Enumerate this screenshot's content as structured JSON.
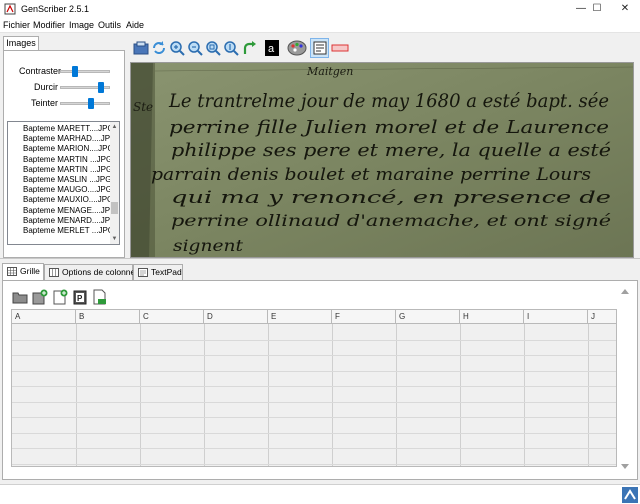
{
  "window": {
    "title": "GenScriber 2.5.1"
  },
  "menu": {
    "items": [
      "Fichier",
      "Modifier",
      "Image",
      "Outils",
      "Aide"
    ]
  },
  "left_panel": {
    "tab": "Images",
    "sliders": [
      {
        "label": "Contraster",
        "value": 0.3
      },
      {
        "label": "Durcir",
        "value": 0.82
      },
      {
        "label": "Teinter",
        "value": 0.62
      }
    ],
    "files": [
      "Bapteme MARETT....JPG",
      "Bapteme MARHAD....JPG",
      "Bapteme MARION....JPG",
      "Bapteme MARTIN ...JPG",
      "Bapteme MARTIN ...JPG",
      "Bapteme MASLIN ...JPG",
      "Bapteme MAUGO....JPG",
      "Bapteme MAUXIO....JPG",
      "Bapteme MENAGE....JPG",
      "Bapteme MENARD....JPG",
      "Bapteme MERLET ...JPG"
    ]
  },
  "image_toolbar": [
    "open-image-icon",
    "refresh-icon",
    "zoom-in-icon",
    "zoom-out-icon",
    "zoom-fit-icon",
    "zoom-actual-icon",
    "zoom-width-icon",
    "rotate-icon",
    "text-a-icon",
    "palette-icon",
    "filter-icon",
    "reset-icon"
  ],
  "image_view": {
    "lines": [
      "Le trantrelme jour de may 1680 a esté bapt. sée",
      "perrine fille Julien morel et de Laurence",
      "philippe ses pere et mere, la quelle a esté",
      "parrain denis boulet et maraine perrine Lours",
      "qui ma y renoncé, en presence de",
      "perrine ollinaud d'anemache, et ont signé",
      "signent"
    ],
    "margin_note": "Ste",
    "header_text": "Maitgen"
  },
  "bottom_tabs": [
    {
      "label": "Grille",
      "active": true
    },
    {
      "label": "Options de colonne",
      "active": false
    },
    {
      "label": "TextPad",
      "active": false
    }
  ],
  "grid": {
    "columns": [
      "A",
      "B",
      "C",
      "D",
      "E",
      "F",
      "G",
      "H",
      "I",
      "J"
    ],
    "row_count": 9
  },
  "colors": {
    "accent": "#0078d7",
    "parchment": "#7d8763"
  }
}
